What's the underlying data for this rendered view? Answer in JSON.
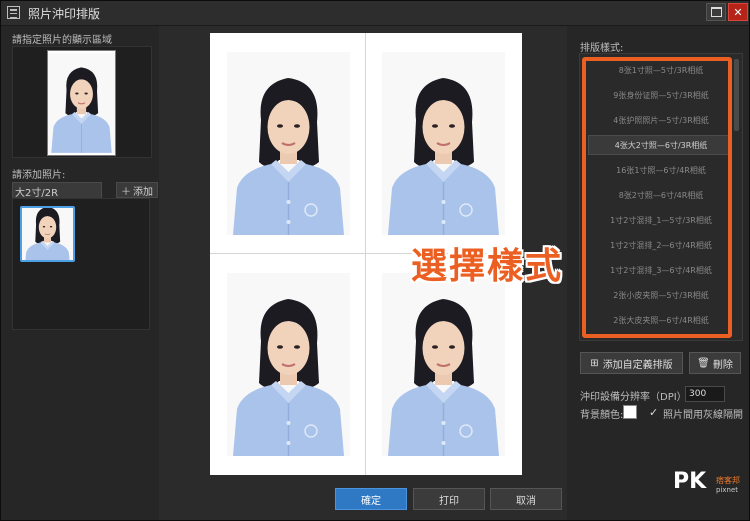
{
  "window": {
    "title": "照片沖印排版"
  },
  "left_panel": {
    "preview_label": "請指定照片的顯示區域",
    "add_photo_label": "請添加照片:",
    "tab_label": "大2寸/2R",
    "add_button_label": "添加"
  },
  "layout_panel": {
    "label": "排版樣式:",
    "items": [
      "8张1寸照—5寸/3R相纸",
      "9张身份证照—5寸/3R相纸",
      "4张护照照片—5寸/3R相纸",
      "4张大2寸照—6寸/3R相纸",
      "16张1寸照—6寸/4R相纸",
      "8张2寸照—6寸/4R相纸",
      "1寸2寸混排_1—5寸/3R相纸",
      "1寸2寸混排_2—6寸/4R相纸",
      "1寸2寸混排_3—6寸/4R相纸",
      "2张小皮夹照—5寸/3R相纸",
      "2张大皮夹照—6寸/4R相纸"
    ],
    "selected_index": 3,
    "callout": "選擇樣式"
  },
  "actions": {
    "add_custom_label": "添加自定義排版",
    "delete_label": "刪除",
    "dpi_label": "沖印設備分辨率（DPI）:",
    "dpi_value": "300",
    "bg_color_label": "背景顏色:",
    "bg_color": "#ffffff",
    "separator_label": "照片間用灰線隔開",
    "separator_checked": true
  },
  "footer": {
    "confirm_label": "確定",
    "print_label": "打印",
    "cancel_label": "取消"
  },
  "watermark": {
    "logo": "PK",
    "line1": "痞客邦",
    "line2": "pixnet"
  },
  "colors": {
    "accent": "#2f78c4",
    "highlight": "#ec5f22",
    "close": "#b52419"
  }
}
